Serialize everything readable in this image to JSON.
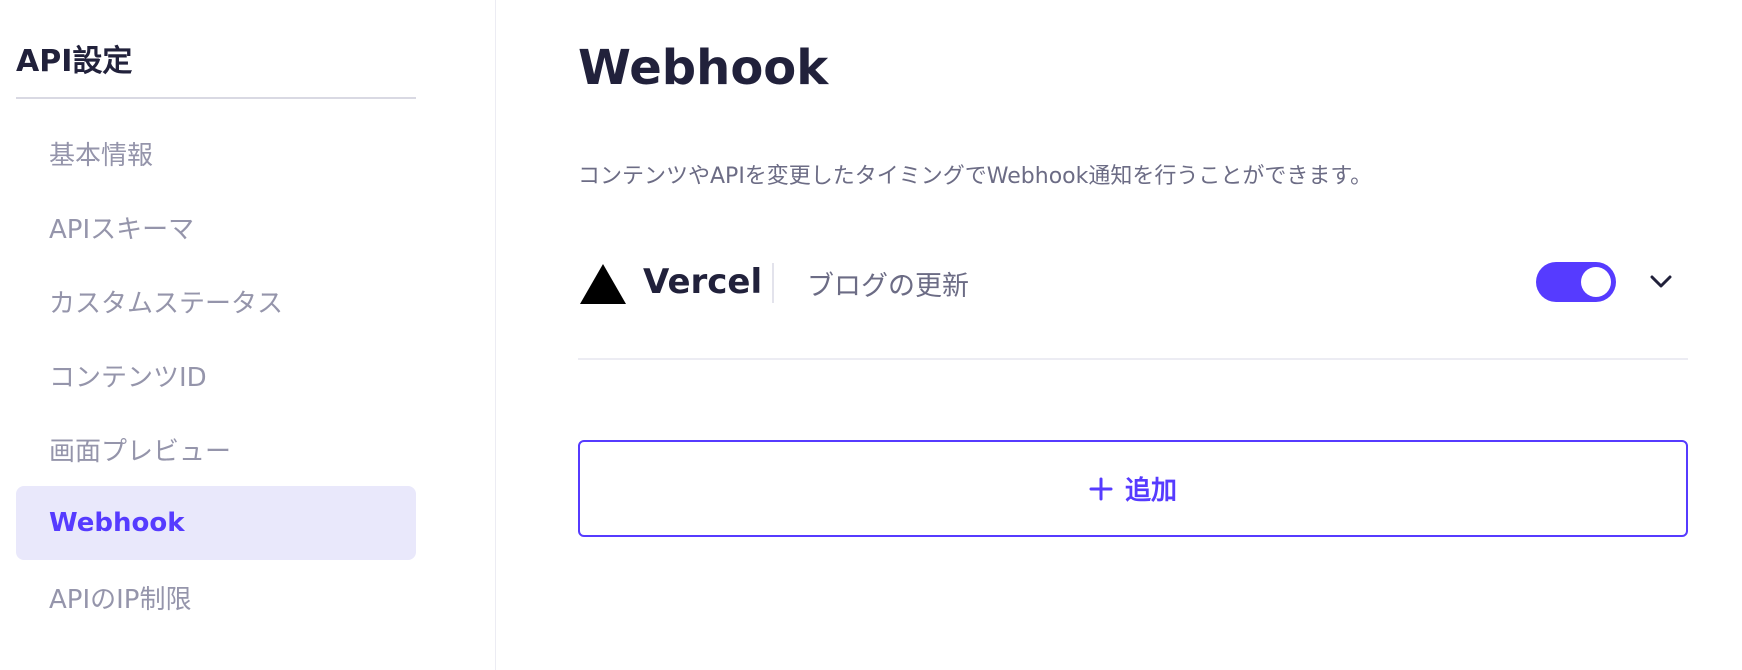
{
  "sidebar": {
    "title": "API設定",
    "items": [
      {
        "label": "基本情報",
        "active": false
      },
      {
        "label": "APIスキーマ",
        "active": false
      },
      {
        "label": "カスタムステータス",
        "active": false
      },
      {
        "label": "コンテンツID",
        "active": false
      },
      {
        "label": "画面プレビュー",
        "active": false
      },
      {
        "label": "Webhook",
        "active": true
      },
      {
        "label": "APIのIP制限",
        "active": false
      }
    ]
  },
  "main": {
    "title": "Webhook",
    "description": "コンテンツやAPIを変更したタイミングでWebhook通知を行うことができます。",
    "webhooks": [
      {
        "service": "Vercel",
        "service_icon": "vercel-triangle-icon",
        "name": "ブログの更新",
        "enabled": true,
        "expand_icon": "chevron-down-icon"
      }
    ],
    "add_button": {
      "label": "追加",
      "icon": "plus-icon"
    }
  },
  "colors": {
    "accent": "#563bff",
    "active_bg": "#e9e8fb",
    "text_primary": "#21213b",
    "text_muted": "#9595ab",
    "text_secondary": "#6c6c85"
  }
}
